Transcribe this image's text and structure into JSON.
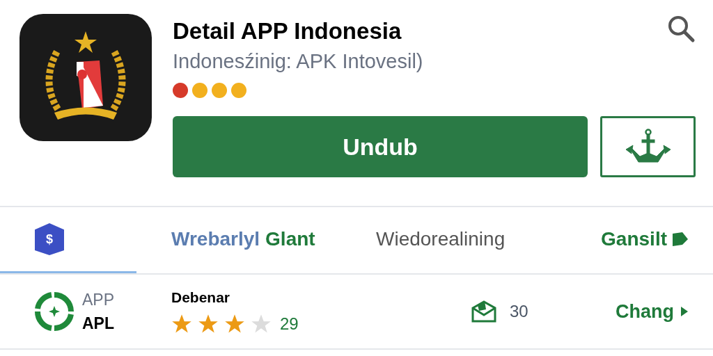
{
  "app": {
    "title": "Detail APP Indonesia",
    "subtitle": "Indonesźinig: APK Intovesil)",
    "dots": [
      {
        "color": "#d63a2a"
      },
      {
        "color": "#f2b01e"
      },
      {
        "color": "#f2b01e"
      },
      {
        "color": "#f2b01e"
      }
    ],
    "install_button": "Undub"
  },
  "tabs": [
    {
      "kind": "icon",
      "icon_text": "$",
      "selected": true
    },
    {
      "kind": "text",
      "label": "Wrebarlyl",
      "accent": "Glant",
      "selected": false
    },
    {
      "kind": "text",
      "label": "Wiedorealining",
      "selected": false
    },
    {
      "kind": "link",
      "label": "Gansilt",
      "selected": false
    }
  ],
  "info_row": {
    "badge_top": "APP",
    "badge_bottom": "APL",
    "rating_label": "Debenar",
    "stars": 3,
    "rating_count": "29",
    "downloads": "30",
    "link": "Chang"
  }
}
